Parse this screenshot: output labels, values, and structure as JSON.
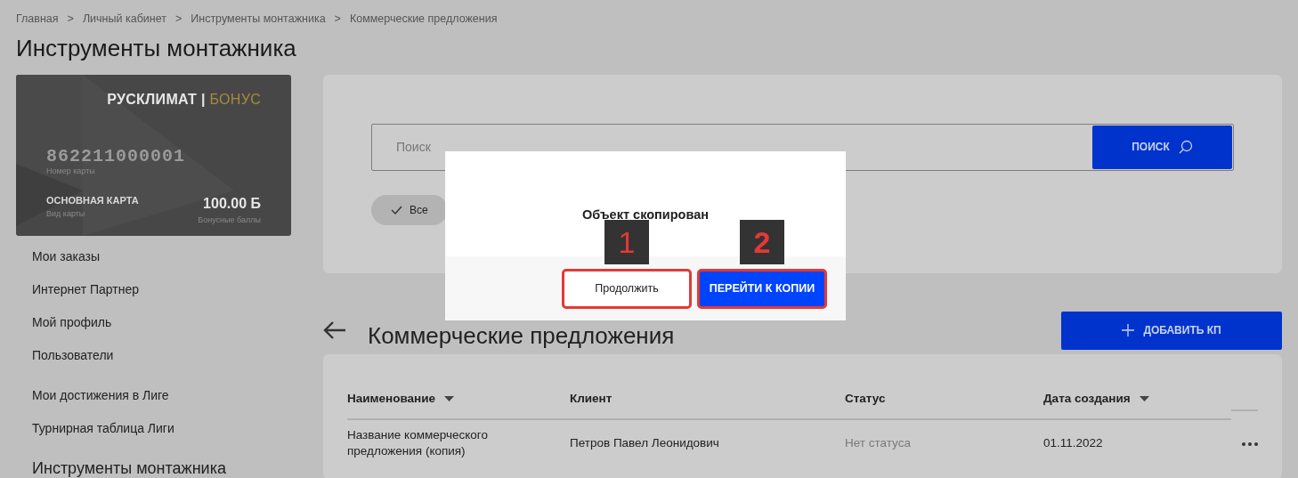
{
  "breadcrumbs": [
    "Главная",
    "Личный кабинет",
    "Инструменты монтажника",
    "Коммерческие предложения"
  ],
  "breadcrumb_separator": ">",
  "page_title": "Инструменты монтажника",
  "bonus_card": {
    "brand": "РУСКЛИМАТ",
    "brand_separator": "|",
    "brand_accent": "БОНУС",
    "number": "862211000001",
    "number_label": "Номер карты",
    "type": "ОСНОВНАЯ КАРТА",
    "type_label": "Вид карты",
    "balance": "100.00 Б",
    "balance_label": "Бонусные баллы"
  },
  "sidebar": {
    "groups": [
      {
        "items": [
          "Мои заказы",
          "Интернет Партнер",
          "Мой профиль",
          "Пользователи"
        ]
      },
      {
        "items": [
          "Мои достижения в Лиге",
          "Турнирная таблица Лиги"
        ]
      }
    ],
    "section_title": "Инструменты монтажника"
  },
  "search": {
    "placeholder": "Поиск",
    "button": "ПОИСК"
  },
  "filters": [
    {
      "label": "Все",
      "selected": true
    }
  ],
  "section": {
    "title": "Коммерческие предложения",
    "add_button": "ДОБАВИТЬ КП"
  },
  "table": {
    "columns": [
      {
        "label": "Наименование",
        "sortable": true
      },
      {
        "label": "Клиент",
        "sortable": false
      },
      {
        "label": "Статус",
        "sortable": false
      },
      {
        "label": "Дата создания",
        "sortable": true
      }
    ],
    "rows": [
      {
        "name": "Название коммерческого предложения (копия)",
        "client": "Петров Павел Леонидович",
        "status": "Нет статуса",
        "date": "01.11.2022"
      }
    ]
  },
  "dialog": {
    "message": "Объект скопирован",
    "buttons": [
      {
        "label": "Продолжить",
        "kind": "secondary",
        "annotation": "1"
      },
      {
        "label": "ПЕРЕЙТИ К КОПИИ",
        "kind": "primary",
        "annotation": "2"
      }
    ]
  }
}
